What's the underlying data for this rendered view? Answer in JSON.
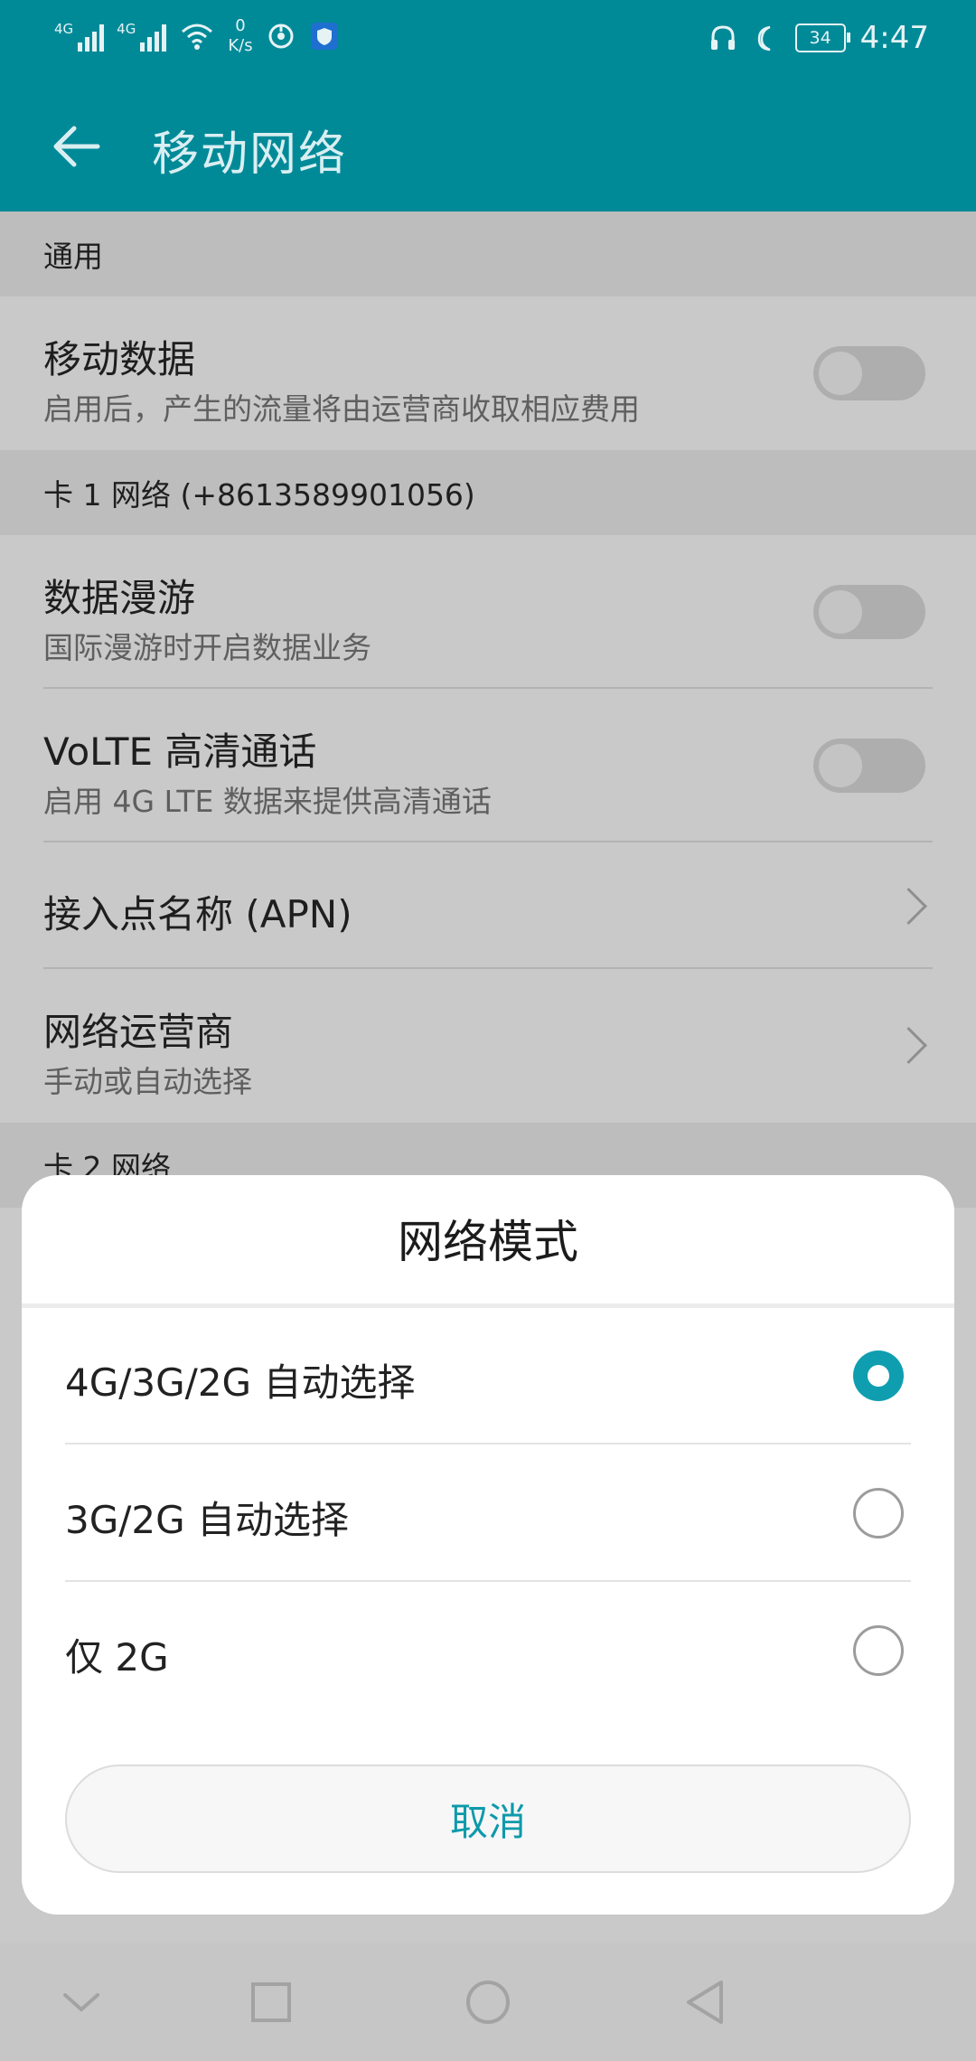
{
  "status_bar": {
    "signal1_label": "4G",
    "signal2_label": "4G",
    "speed_value": "0",
    "speed_unit": "K/s",
    "battery": "34",
    "time": "4:47"
  },
  "toolbar": {
    "title": "移动网络"
  },
  "sections": {
    "general_header": "通用",
    "mobile_data": {
      "title": "移动数据",
      "subtitle": "启用后，产生的流量将由运营商收取相应费用"
    },
    "card1_header": "卡 1 网络 (+8613589901056)",
    "roaming": {
      "title": "数据漫游",
      "subtitle": "国际漫游时开启数据业务"
    },
    "volte": {
      "title": "VoLTE 高清通话",
      "subtitle": "启用 4G LTE 数据来提供高清通话"
    },
    "apn": {
      "title": "接入点名称 (APN)"
    },
    "operator": {
      "title": "网络运营商",
      "subtitle": "手动或自动选择"
    },
    "card2_header_partial": "卡 2 网络"
  },
  "dialog": {
    "title": "网络模式",
    "options": [
      {
        "label": "4G/3G/2G 自动选择",
        "selected": true
      },
      {
        "label": "3G/2G 自动选择",
        "selected": false
      },
      {
        "label": "仅 2G",
        "selected": false
      }
    ],
    "cancel_label": "取消"
  },
  "colors": {
    "accent": "#008a98",
    "radio_selected": "#0f9eb0"
  }
}
